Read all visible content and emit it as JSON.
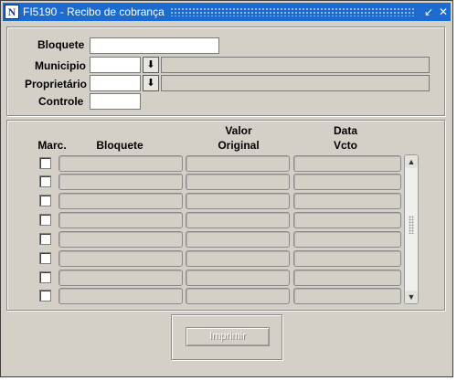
{
  "window": {
    "title": "FI5190 - Recibo de cobrança",
    "app_icon": "N",
    "minimize_glyph": "↙",
    "close_glyph": "✕"
  },
  "form": {
    "bloquete_label": "Bloquete",
    "bloquete_value": "",
    "municipio_label": "Municipio",
    "municipio_value": "",
    "municipio_desc": "",
    "proprietario_label": "Proprietário",
    "proprietario_value": "",
    "proprietario_desc": "",
    "controle_label": "Controle",
    "controle_value": "",
    "lov_glyph": "⬇"
  },
  "grid": {
    "headers": {
      "marc": "Marc.",
      "bloquete": "Bloquete",
      "valor_line1": "Valor",
      "valor_line2": "Original",
      "data_line1": "Data",
      "data_line2": "Vcto"
    },
    "rows": [
      {
        "marc": false,
        "bloquete": "",
        "valor": "",
        "vcto": ""
      },
      {
        "marc": false,
        "bloquete": "",
        "valor": "",
        "vcto": ""
      },
      {
        "marc": false,
        "bloquete": "",
        "valor": "",
        "vcto": ""
      },
      {
        "marc": false,
        "bloquete": "",
        "valor": "",
        "vcto": ""
      },
      {
        "marc": false,
        "bloquete": "",
        "valor": "",
        "vcto": ""
      },
      {
        "marc": false,
        "bloquete": "",
        "valor": "",
        "vcto": ""
      },
      {
        "marc": false,
        "bloquete": "",
        "valor": "",
        "vcto": ""
      },
      {
        "marc": false,
        "bloquete": "",
        "valor": "",
        "vcto": ""
      }
    ],
    "scroll_up_glyph": "▲",
    "scroll_down_glyph": "▼"
  },
  "actions": {
    "imprimir_label": "Imprimir"
  }
}
